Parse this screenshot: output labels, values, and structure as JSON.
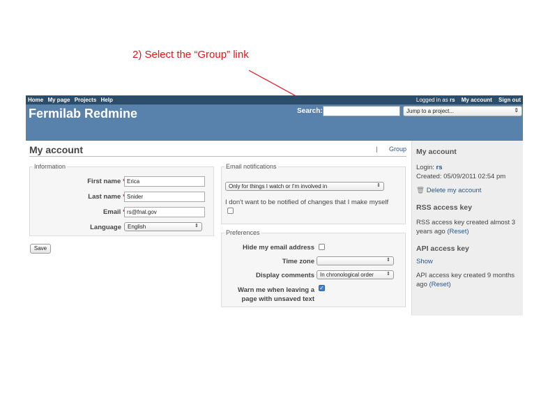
{
  "annotation": {
    "text": "2) Select the “Group” link",
    "color": "#e5141c"
  },
  "topmenu": {
    "items": [
      "Home",
      "My page",
      "Projects",
      "Help"
    ],
    "logged_in_prefix": "Logged in as",
    "user": "rs",
    "my_account": "My account",
    "sign_out": "Sign out"
  },
  "header": {
    "title": "Fermilab Redmine",
    "search_label": "Search:",
    "search_value": "",
    "jump_label": "Jump to a project..."
  },
  "page": {
    "title": "My account",
    "separator": "|",
    "group_link": "Group"
  },
  "information": {
    "legend": "Information",
    "first_name_label": "First name",
    "first_name_value": "Erica",
    "last_name_label": "Last name",
    "last_name_value": "Snider",
    "email_label": "Email",
    "email_value": "rs@fnal.gov",
    "language_label": "Language",
    "language_value": "English",
    "required_mark": "*"
  },
  "save_label": "Save",
  "email_notifications": {
    "legend": "Email notifications",
    "selected": "Only for things I watch or I'm involved in",
    "no_self_label": "I don't want to be notified of changes that I make myself",
    "no_self_checked": false
  },
  "preferences": {
    "legend": "Preferences",
    "hide_email_label": "Hide my email address",
    "hide_email_checked": false,
    "time_zone_label": "Time zone",
    "time_zone_value": "",
    "display_comments_label": "Display comments",
    "display_comments_value": "In chronological order",
    "warn_label_1": "Warn me when leaving a",
    "warn_label_2": "page with unsaved text",
    "warn_checked": true
  },
  "sidebar": {
    "title": "My account",
    "login_label": "Login:",
    "login_value": "rs",
    "created_text": "Created: 05/09/2011 02:54 pm",
    "delete_label": "Delete my account",
    "rss_title": "RSS access key",
    "rss_text_1": "RSS access key created almost 3",
    "rss_text_2": "years ago",
    "rss_reset": "(Reset)",
    "api_title": "API access key",
    "api_show": "Show",
    "api_text_1": "API access key created 9 months",
    "api_text_2": "ago",
    "api_reset": "(Reset)"
  }
}
